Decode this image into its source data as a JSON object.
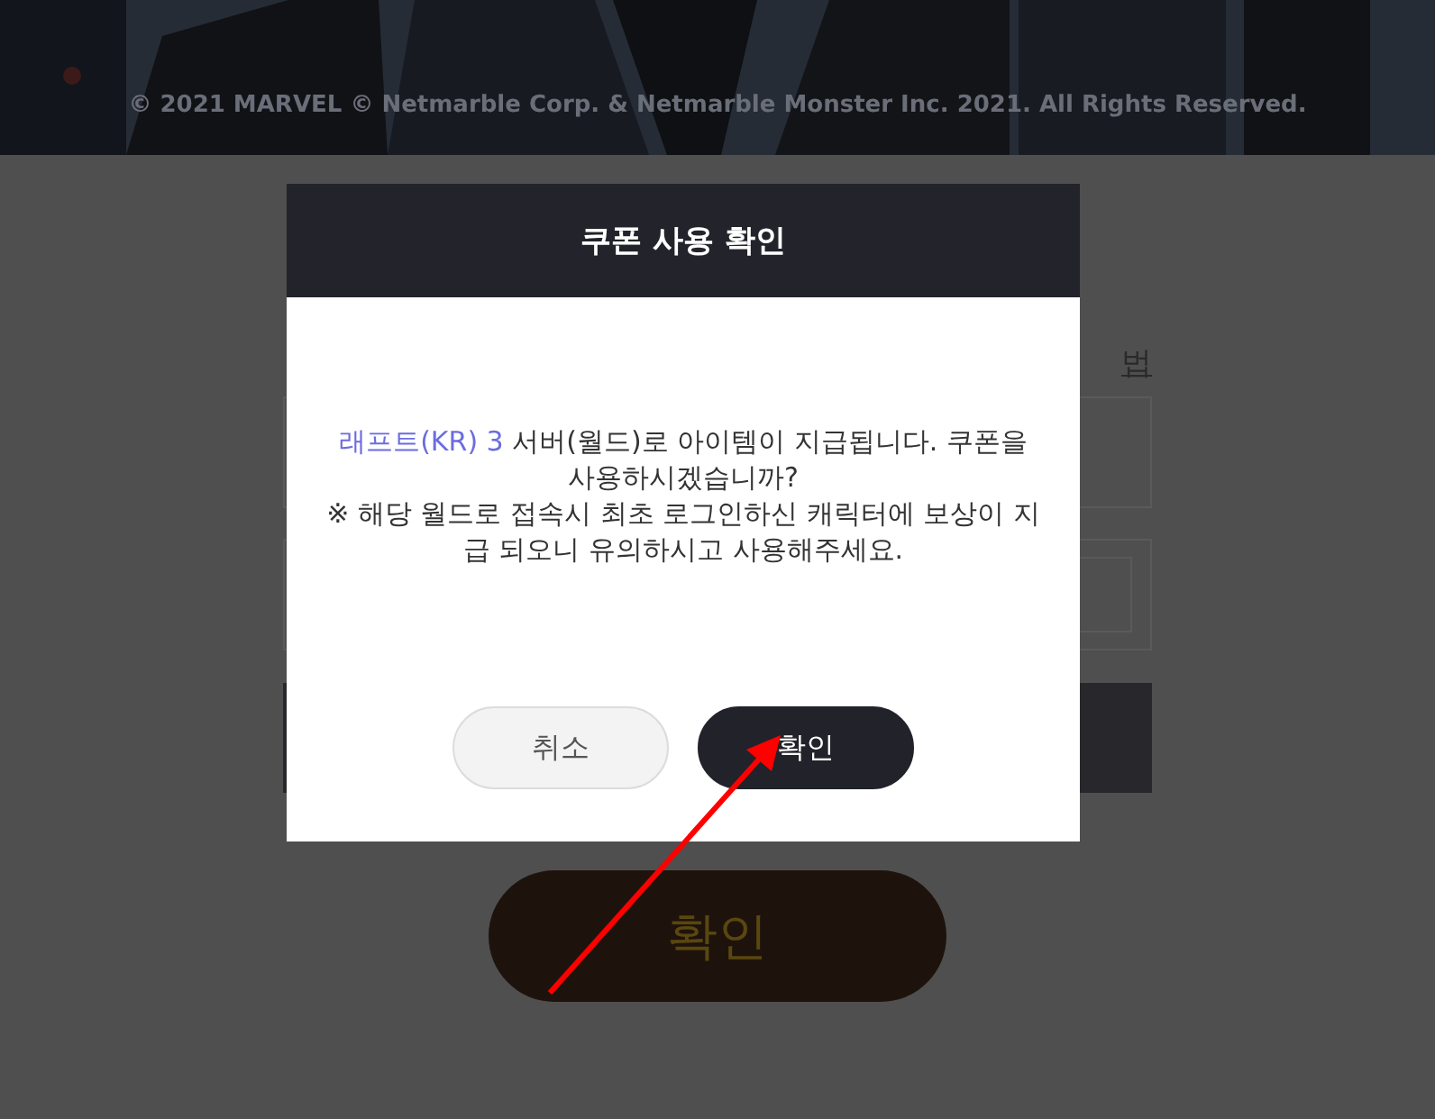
{
  "banner": {
    "kind": "picture",
    "copyright": "© 2021 MARVEL © Netmarble Corp. & Netmarble Monster Inc. 2021. All Rights Reserved."
  },
  "form": {
    "link": "법",
    "submit": "확인"
  },
  "dialog": {
    "title": "쿠폰 사용 확인",
    "message": {
      "highlight": "래프트(KR) 3",
      "text": " 서버(월드)로 아이템이 지급됩니다. 쿠폰을 사용하시겠습니까?"
    },
    "notice": "※ 해당 월드로 접속시 최초 로그인하신 캐릭터에 보상이 지급 되오니 유의하시고 사용해주세요.",
    "buttons": [
      {
        "kind": "cancel",
        "label": "취소"
      },
      {
        "kind": "confirm",
        "label": "확인"
      }
    ]
  }
}
